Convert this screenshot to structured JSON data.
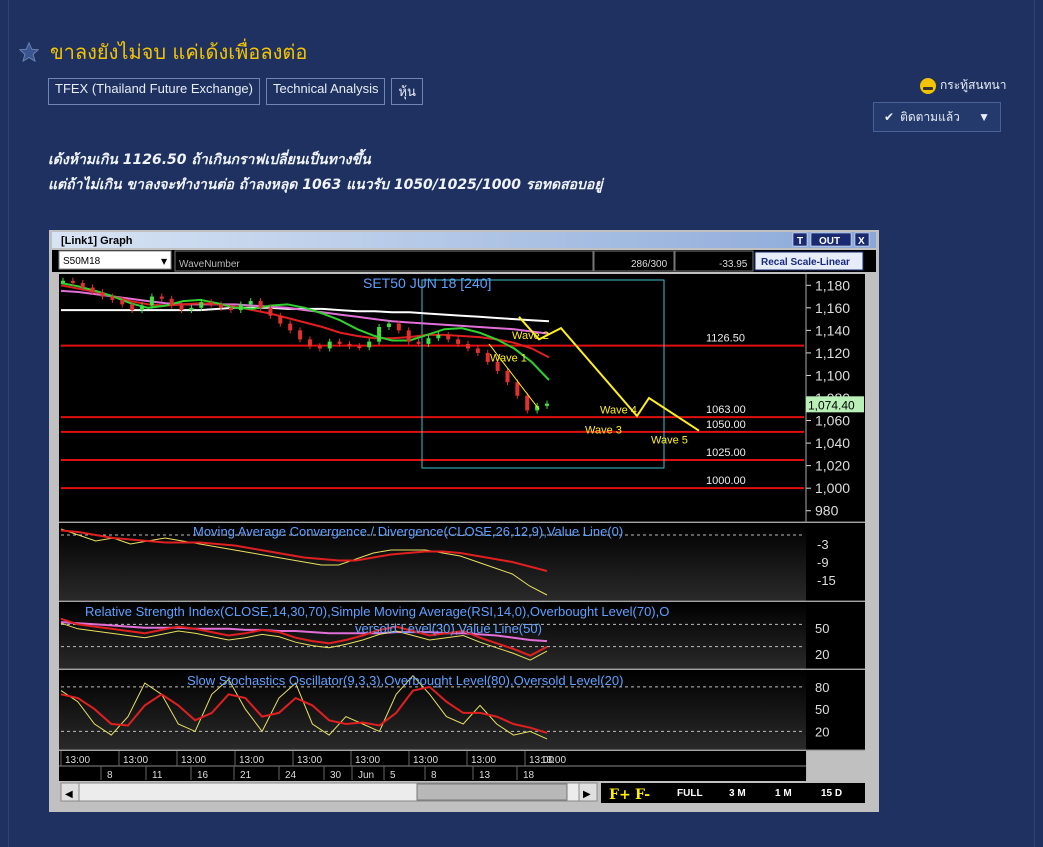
{
  "post": {
    "title": "ขาลงยังไม่จบ แค่เด้งเพื่อลงต่อ",
    "tags": [
      "TFEX (Thailand Future Exchange)",
      "Technical Analysis",
      "หุ้น"
    ],
    "room_label": "กระทู้สนทนา",
    "follow_label": "ติดตามแล้ว",
    "body_lines": [
      "เด้งห้ามเกิน 1126.50 ถ้าเกินกราฟเปลี่ยนเป็นทางขึ้น",
      "แต่ถ้าไม่เกิน ขาลงจะทำงานต่อ ถ้าลงหลุด 1063 แนวรับ 1050/1025/1000 รอทดสอบอยู่"
    ]
  },
  "window": {
    "title": "[Link1] Graph",
    "btn_t": "T",
    "btn_out": "OUT",
    "btn_x": "X",
    "symbol": "S50M18",
    "indicator_field": "WaveNumber",
    "count": "286/300",
    "change": "-33.95",
    "recal_label": "Recal Scale-Linear",
    "zoom_buttons": [
      "F+",
      "F-",
      "FULL",
      "3 M",
      "1 M",
      "15 D"
    ]
  },
  "colors": {
    "chart_bg": "#000000",
    "support_line": "#e01010",
    "wave_line": "#ffee22",
    "box": "#40c0d0",
    "label_text": "#5fa0ff",
    "price_tag": "#b8f0b8"
  },
  "chart_data": {
    "type": "line",
    "title": "SET50 JUN 18   [240]",
    "y_range": [
      970,
      1190
    ],
    "y_ticks": [
      "1,180",
      "1,160",
      "1,140",
      "1,120",
      "1,100",
      "1,080",
      "1,060",
      "1,040",
      "1,020",
      "1,000",
      "980"
    ],
    "last_price_label": "1,074.40",
    "levels": [
      {
        "label": "1126.50",
        "value": 1126.5
      },
      {
        "label": "1063.00",
        "value": 1063
      },
      {
        "label": "1050.00",
        "value": 1050
      },
      {
        "label": "1025.00",
        "value": 1025
      },
      {
        "label": "1000.00",
        "value": 1000
      }
    ],
    "wave_labels": [
      "Wave 2",
      "Wave 1",
      "Wave 4",
      "Wave 3",
      "Wave 5"
    ],
    "wave_path": [
      1152,
      1132,
      1142,
      1064,
      1080,
      1051
    ],
    "price_series": [
      1184,
      1182,
      1178,
      1174,
      1170,
      1167,
      1163,
      1158,
      1162,
      1170,
      1168,
      1162,
      1158,
      1160,
      1165,
      1163,
      1160,
      1158,
      1163,
      1166,
      1160,
      1153,
      1146,
      1140,
      1132,
      1126,
      1124,
      1130,
      1128,
      1126,
      1125,
      1130,
      1143,
      1146,
      1140,
      1130,
      1128,
      1133,
      1136,
      1132,
      1128,
      1124,
      1120,
      1112,
      1104,
      1094,
      1082,
      1069,
      1073,
      1075
    ],
    "ma_white": [
      1158,
      1158,
      1158,
      1158,
      1158,
      1158,
      1158,
      1158,
      1158,
      1159,
      1160,
      1160,
      1160,
      1159,
      1159,
      1159,
      1158,
      1157,
      1157,
      1156,
      1156,
      1155,
      1154,
      1153,
      1152,
      1151,
      1150,
      1149,
      1148
    ],
    "ma_pink": [
      1175,
      1174,
      1172,
      1170,
      1168,
      1166,
      1164,
      1163,
      1163,
      1163,
      1163,
      1162,
      1161,
      1160,
      1158,
      1156,
      1154,
      1152,
      1150,
      1148,
      1147,
      1146,
      1145,
      1144,
      1143,
      1142,
      1141,
      1139,
      1137
    ],
    "ma_red": [
      1180,
      1177,
      1174,
      1170,
      1166,
      1163,
      1162,
      1163,
      1164,
      1163,
      1161,
      1158,
      1155,
      1151,
      1147,
      1143,
      1138,
      1135,
      1133,
      1133,
      1134,
      1136,
      1136,
      1135,
      1134,
      1132,
      1129,
      1124,
      1116
    ],
    "ma_green": [
      1182,
      1179,
      1175,
      1170,
      1164,
      1160,
      1162,
      1166,
      1167,
      1164,
      1160,
      1159,
      1162,
      1163,
      1160,
      1155,
      1149,
      1141,
      1135,
      1131,
      1131,
      1136,
      1141,
      1142,
      1138,
      1132,
      1124,
      1112,
      1096
    ],
    "macd": {
      "title": "Moving Average Convergence / Divergence(CLOSE,26,12,9),Value Line(0)",
      "y_ticks": [
        "-3",
        "-9",
        "-15"
      ],
      "signal": [
        1.5,
        1,
        0,
        -1,
        -1.5,
        -2,
        -2.5,
        -2.5,
        -2.5,
        -3,
        -3.5,
        -4.5,
        -5.5,
        -6.5,
        -7.5,
        -8,
        -8.5,
        -8.5,
        -7.5,
        -6.5,
        -6,
        -5.5,
        -5.5,
        -6,
        -7,
        -8,
        -9,
        -10.5,
        -12
      ],
      "macd": [
        2,
        0,
        -2,
        -1,
        -3,
        -2,
        -1,
        -2,
        -3,
        -4,
        -5,
        -6,
        -7,
        -8,
        -9,
        -10,
        -10,
        -8,
        -6,
        -5,
        -5,
        -5,
        -6,
        -7,
        -9,
        -11,
        -13,
        -17,
        -20
      ]
    },
    "rsi": {
      "title": "Relative Strength Index(CLOSE,14,30,70),Simple Moving Average(RSI,14,0),Overbought Level(70),Oversold Level(30),Value Line(50)",
      "y_ticks": [
        "50",
        "20"
      ],
      "rsi": [
        55,
        50,
        48,
        46,
        44,
        42,
        45,
        48,
        46,
        43,
        40,
        42,
        45,
        43,
        38,
        35,
        33,
        36,
        40,
        45,
        48,
        44,
        40,
        42,
        44,
        38,
        33,
        28,
        22,
        30
      ],
      "sma": [
        52,
        51,
        50,
        49,
        48,
        47,
        47,
        47,
        46,
        46,
        46,
        45,
        45,
        44,
        44,
        43,
        42,
        42,
        42,
        42,
        43,
        43,
        43,
        42,
        42,
        41,
        40,
        38,
        36,
        35
      ]
    },
    "stoch": {
      "title": "Slow Stochastics Oscillator(9,3,3),Overbought Level(80),Oversold Level(20)",
      "y_ticks": [
        "80",
        "50",
        "20"
      ],
      "k": [
        75,
        60,
        30,
        15,
        40,
        85,
        70,
        30,
        20,
        70,
        90,
        50,
        20,
        65,
        85,
        30,
        15,
        40,
        30,
        20,
        70,
        95,
        70,
        40,
        30,
        55,
        30,
        15,
        20,
        10
      ],
      "d": [
        70,
        65,
        50,
        30,
        28,
        55,
        70,
        55,
        35,
        45,
        70,
        65,
        40,
        45,
        65,
        55,
        35,
        30,
        32,
        28,
        45,
        75,
        80,
        60,
        45,
        45,
        40,
        30,
        25,
        18
      ]
    },
    "x_ticks_top": [
      "13:00",
      "13:00",
      "13:00",
      "13:00",
      "13:00",
      "13:00",
      "13:00",
      "13:00",
      "13:00",
      "13:00",
      "13:00",
      "13:00",
      "13:00",
      "13:00",
      "13:00",
      "13:00",
      "13:00"
    ],
    "x_ticks_bottom": [
      "8",
      "11",
      "16",
      "21",
      "24",
      "30",
      "Jun",
      "5",
      "8",
      "13",
      "18"
    ]
  }
}
